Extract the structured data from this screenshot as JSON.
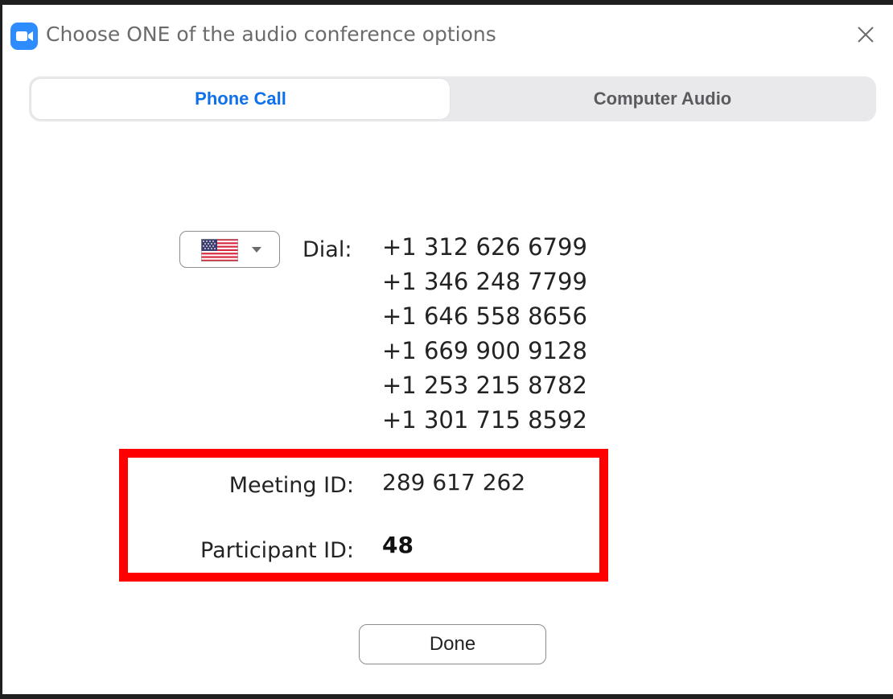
{
  "window": {
    "title": "Choose ONE of the audio conference options",
    "app_icon": "zoom-camera-icon",
    "close_icon": "close-icon"
  },
  "tabs": [
    {
      "label": "Phone Call",
      "active": true
    },
    {
      "label": "Computer Audio",
      "active": false
    }
  ],
  "dial": {
    "country": "United States",
    "country_icon": "us-flag-icon",
    "label": "Dial:",
    "numbers": [
      "+1 312 626 6799",
      "+1 346 248 7799",
      "+1 646 558 8656",
      "+1 669 900 9128",
      "+1 253 215 8782",
      "+1 301 715 8592"
    ]
  },
  "meeting": {
    "meeting_id_label": "Meeting ID:",
    "meeting_id": "289 617 262",
    "participant_id_label": "Participant ID:",
    "participant_id": "48"
  },
  "footer": {
    "done_label": "Done"
  },
  "colors": {
    "accent": "#0e71eb",
    "highlight": "#ff0000",
    "tab_background": "#e9e9ec"
  }
}
